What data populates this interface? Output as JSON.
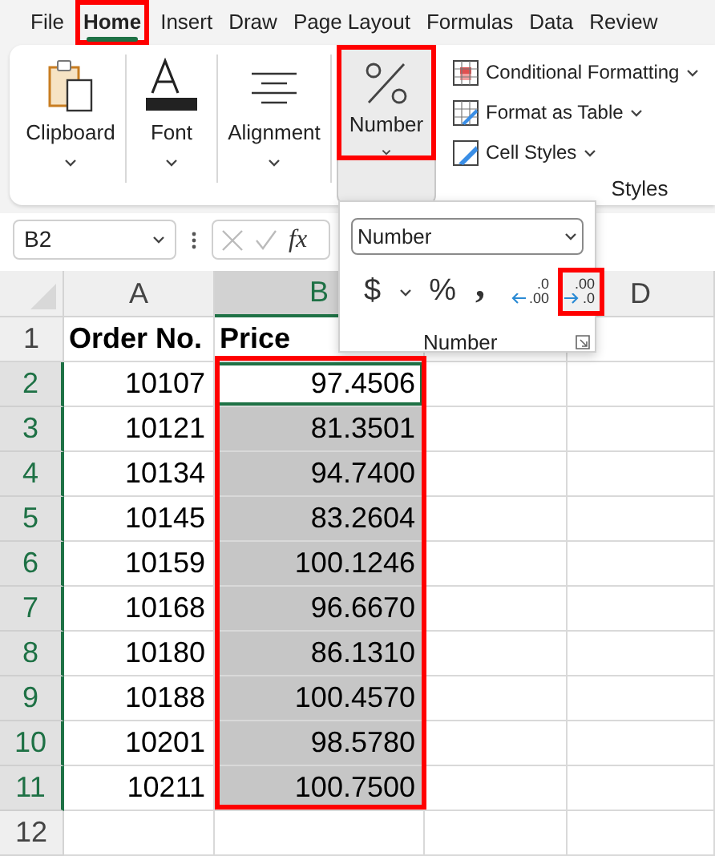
{
  "tabs": [
    {
      "label": "File",
      "selected": false,
      "highlighted": false
    },
    {
      "label": "Home",
      "selected": true,
      "highlighted": true
    },
    {
      "label": "Insert",
      "selected": false,
      "highlighted": false
    },
    {
      "label": "Draw",
      "selected": false,
      "highlighted": false
    },
    {
      "label": "Page Layout",
      "selected": false,
      "highlighted": false
    },
    {
      "label": "Formulas",
      "selected": false,
      "highlighted": false
    },
    {
      "label": "Data",
      "selected": false,
      "highlighted": false
    },
    {
      "label": "Review",
      "selected": false,
      "highlighted": false
    }
  ],
  "ribbon": {
    "groups": [
      {
        "kind": "clipboard",
        "label": "Clipboard",
        "pressed": false,
        "highlighted": false
      },
      {
        "kind": "font",
        "label": "Font",
        "pressed": false,
        "highlighted": false
      },
      {
        "kind": "alignment",
        "label": "Alignment",
        "pressed": false,
        "highlighted": false
      },
      {
        "kind": "number",
        "label": "Number",
        "pressed": true,
        "highlighted": true
      }
    ],
    "styles": {
      "items": [
        {
          "kind": "conditional",
          "label": "Conditional Formatting"
        },
        {
          "kind": "table",
          "label": "Format as Table"
        },
        {
          "kind": "cell-styles",
          "label": "Cell Styles"
        }
      ],
      "label": "Styles"
    }
  },
  "number_flyout": {
    "format": "Number",
    "buttons": [
      {
        "kind": "currency",
        "label": "$",
        "highlighted": false
      },
      {
        "kind": "dropdown",
        "highlighted": false
      },
      {
        "kind": "percent",
        "label": "%",
        "highlighted": false
      },
      {
        "kind": "comma",
        "label": ",",
        "highlighted": false
      },
      {
        "kind": "increase-decimal",
        "top": ".0",
        "bottom": ".00",
        "highlighted": false
      },
      {
        "kind": "decrease-decimal",
        "top": ".00",
        "bottom": ".0",
        "highlighted": true
      }
    ],
    "label": "Number"
  },
  "formula_bar": {
    "name_box": "B2",
    "fx": "fx"
  },
  "table": {
    "columns": [
      {
        "label": "A",
        "selected": false
      },
      {
        "label": "B",
        "selected": true
      },
      {
        "label": "D",
        "selected": false
      }
    ],
    "price_highlighted": true,
    "rows": [
      {
        "row": "1",
        "kind": "header",
        "cells": [
          "Order No.",
          "Price"
        ],
        "selected": false,
        "active": false
      },
      {
        "row": "2",
        "kind": "data",
        "cells": [
          "10107",
          "97.4506"
        ],
        "selected": true,
        "active": true
      },
      {
        "row": "3",
        "kind": "data",
        "cells": [
          "10121",
          "81.3501"
        ],
        "selected": true,
        "active": false
      },
      {
        "row": "4",
        "kind": "data",
        "cells": [
          "10134",
          "94.7400"
        ],
        "selected": true,
        "active": false
      },
      {
        "row": "5",
        "kind": "data",
        "cells": [
          "10145",
          "83.2604"
        ],
        "selected": true,
        "active": false
      },
      {
        "row": "6",
        "kind": "data",
        "cells": [
          "10159",
          "100.1246"
        ],
        "selected": true,
        "active": false
      },
      {
        "row": "7",
        "kind": "data",
        "cells": [
          "10168",
          "96.6670"
        ],
        "selected": true,
        "active": false
      },
      {
        "row": "8",
        "kind": "data",
        "cells": [
          "10180",
          "86.1310"
        ],
        "selected": true,
        "active": false
      },
      {
        "row": "9",
        "kind": "data",
        "cells": [
          "10188",
          "100.4570"
        ],
        "selected": true,
        "active": false
      },
      {
        "row": "10",
        "kind": "data",
        "cells": [
          "10201",
          "98.5780"
        ],
        "selected": true,
        "active": false
      },
      {
        "row": "11",
        "kind": "data",
        "cells": [
          "10211",
          "100.7500"
        ],
        "selected": true,
        "active": false
      },
      {
        "row": "12",
        "kind": "empty",
        "selected": false,
        "active": false
      }
    ]
  }
}
